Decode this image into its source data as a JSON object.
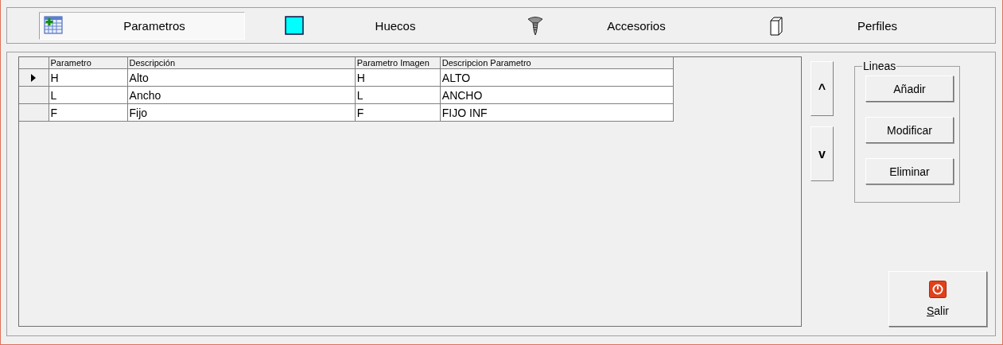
{
  "tabs": [
    {
      "label": "Parametros",
      "kind": "calendar",
      "selected": true
    },
    {
      "label": "Huecos",
      "kind": "square",
      "selected": false
    },
    {
      "label": "Accesorios",
      "kind": "screw",
      "selected": false
    },
    {
      "label": "Perfiles",
      "kind": "prism",
      "selected": false
    }
  ],
  "table": {
    "columns": [
      "Parametro",
      "Descripción",
      "Parametro Imagen",
      "Descripcion Parametro"
    ],
    "rows": [
      {
        "cells": [
          "H",
          "Alto",
          "H",
          "ALTO"
        ],
        "current": true
      },
      {
        "cells": [
          "L",
          "Ancho",
          "L",
          "ANCHO"
        ],
        "current": false
      },
      {
        "cells": [
          "F",
          "Fijo",
          "F",
          "FIJO INF"
        ],
        "current": false
      }
    ]
  },
  "move_buttons": [
    "^",
    "v"
  ],
  "lineas": {
    "title": "Lineas",
    "buttons": [
      "Añadir",
      "Modificar",
      "Eliminar"
    ]
  },
  "exit_button": {
    "label": "Salir"
  }
}
